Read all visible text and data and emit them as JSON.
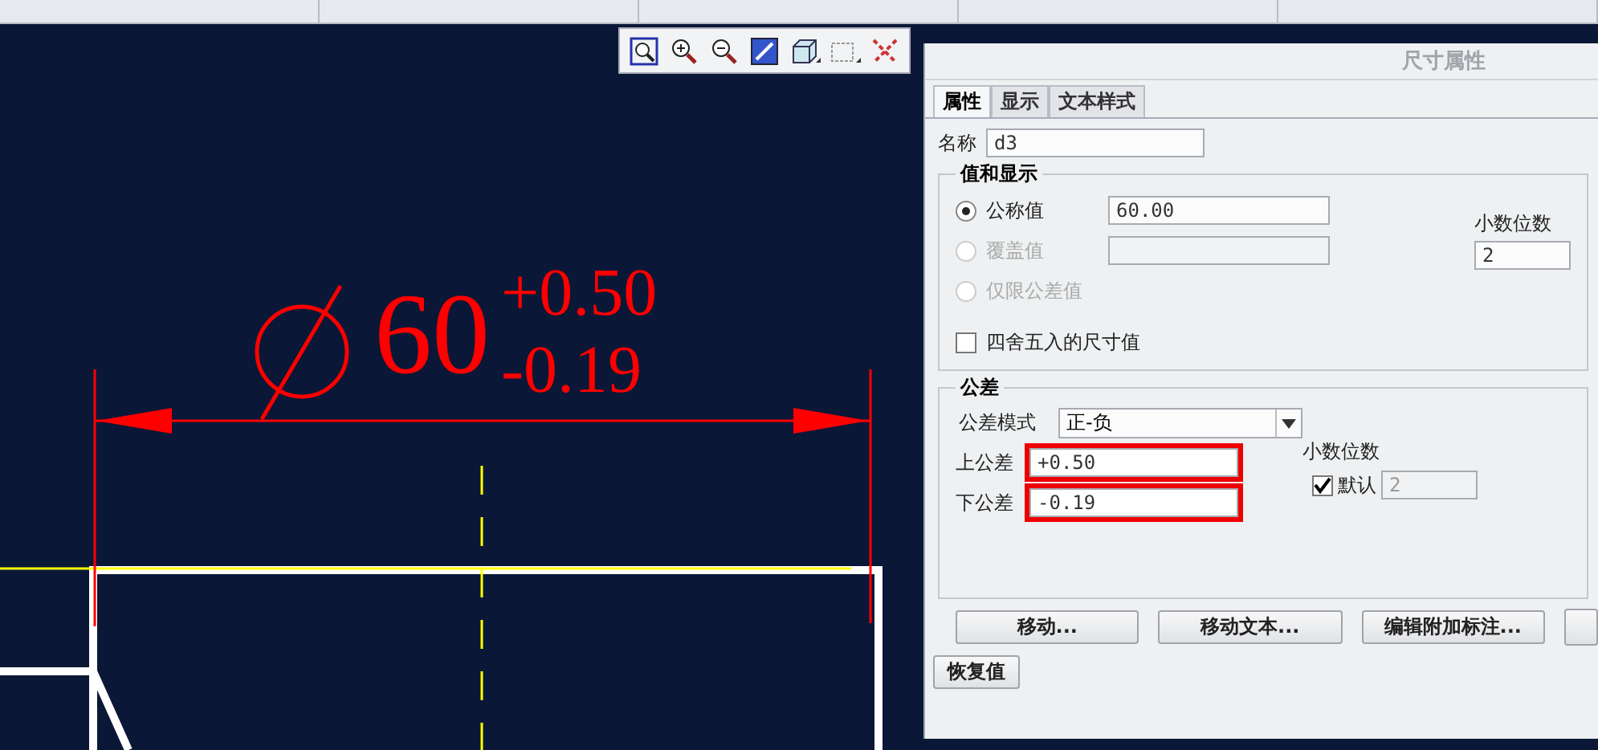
{
  "drawing": {
    "dimension": {
      "value": "60",
      "upper": "+0.50",
      "lower": "-0.19"
    }
  },
  "dialog": {
    "title": "尺寸属性",
    "tabs": [
      {
        "label": "属性",
        "selected": true
      },
      {
        "label": "显示",
        "selected": false
      },
      {
        "label": "文本样式",
        "selected": false
      }
    ],
    "name": {
      "label": "名称",
      "value": "d3"
    },
    "value_group": {
      "title": "值和显示",
      "options": [
        {
          "kind": "field",
          "label": "公称值",
          "selected": true,
          "disabled": false,
          "value": "60.00"
        },
        {
          "kind": "field",
          "label": "覆盖值",
          "selected": false,
          "disabled": true
        },
        {
          "kind": "plain",
          "label": "仅限公差值",
          "selected": false,
          "disabled": true
        }
      ],
      "decimals": {
        "label": "小数位数",
        "value": "2"
      },
      "round": {
        "label": "四舍五入的尺寸值",
        "checked": false
      }
    },
    "tolerance_group": {
      "title": "公差",
      "mode": {
        "label": "公差模式",
        "value": "正-负"
      },
      "upper": {
        "label": "上公差",
        "value": "+0.50",
        "highlighted": true
      },
      "lower": {
        "label": "下公差",
        "value": "-0.19",
        "highlighted": true
      },
      "decimals": {
        "label": "小数位数",
        "default_label": "默认",
        "checked": true,
        "value": "2"
      }
    },
    "buttons": [
      "移动...",
      "移动文本...",
      "编辑附加标注..."
    ],
    "restore_button": "恢复值"
  }
}
